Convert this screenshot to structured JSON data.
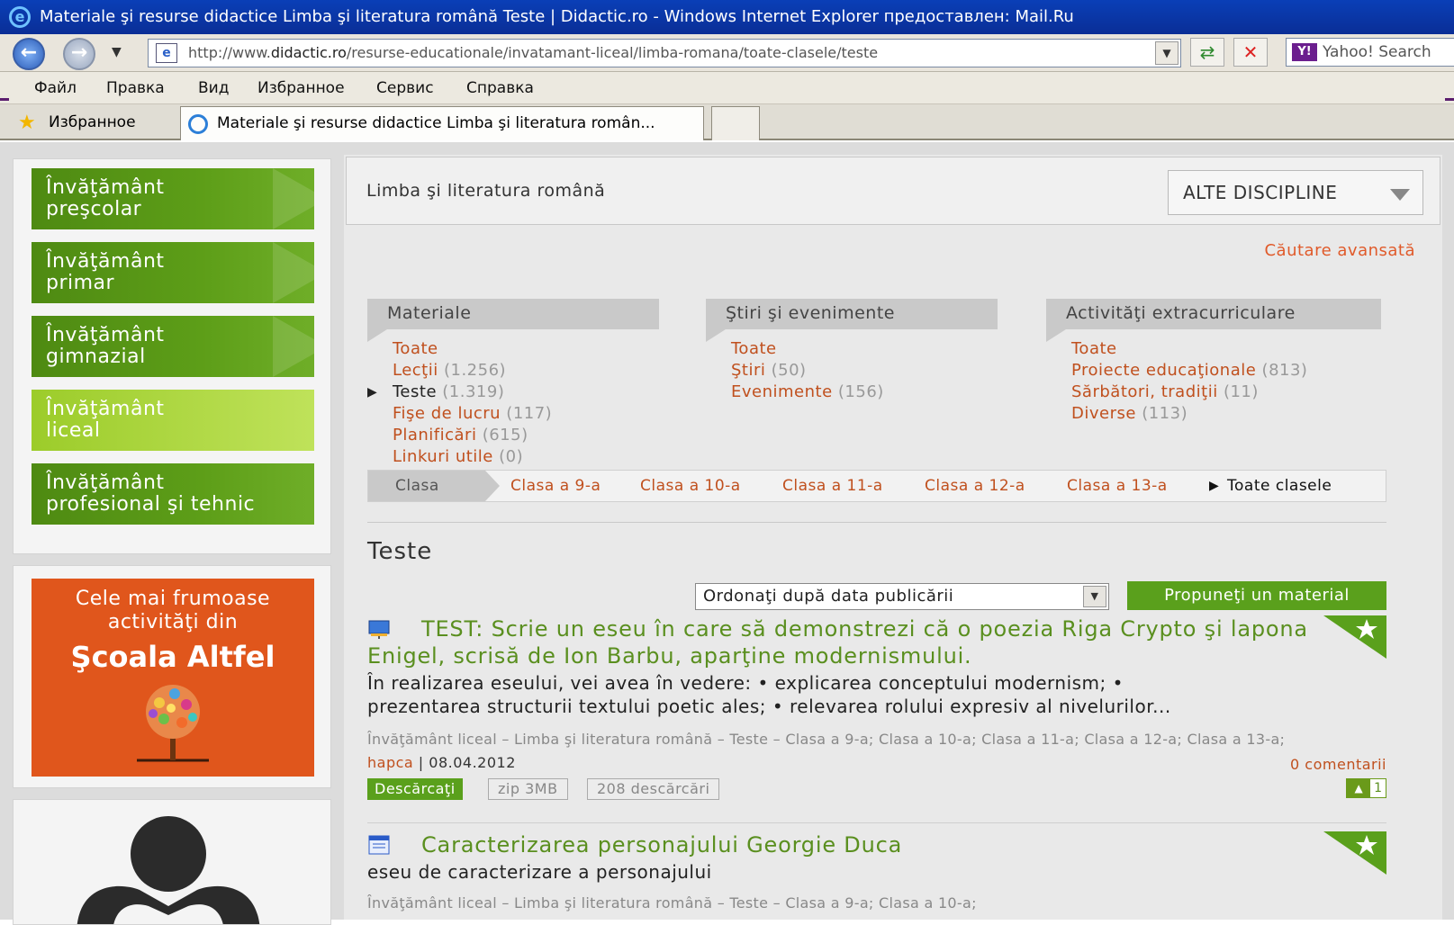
{
  "window": {
    "title": "Materiale şi resurse didactice Limba şi literatura română Teste | Didactic.ro - Windows Internet Explorer предоставлен: Mail.Ru"
  },
  "address": {
    "url_prefix": "http://www.",
    "url_domain": "didactic.ro",
    "url_path": "/resurse-educationale/invatamant-liceal/limba-romana/toate-clasele/teste",
    "search_text": "Yahoo! Search"
  },
  "menu": [
    "Файл",
    "Правка",
    "Вид",
    "Избранное",
    "Сервис",
    "Справка"
  ],
  "favorites": {
    "label": "Избранное",
    "tab_title": "Materiale şi resurse didactice Limba şi literatura român..."
  },
  "sidebar": {
    "levels": [
      {
        "line1": "Învăţământ",
        "line2": "preşcolar"
      },
      {
        "line1": "Învăţământ",
        "line2": "primar"
      },
      {
        "line1": "Învăţământ",
        "line2": "gimnazial"
      },
      {
        "line1": "Învăţământ",
        "line2": "liceal"
      },
      {
        "line1": "Învăţământ",
        "line2": "profesional şi tehnic"
      }
    ],
    "ad_line1": "Cele mai frumoase",
    "ad_line2": "activităţi din",
    "ad_line3": "Şcoala Altfel"
  },
  "discipline": {
    "title": "Limba şi literatura română",
    "other_button": "ALTE DISCIPLINE",
    "advanced_search": "Căutare avansată"
  },
  "columns": {
    "materiale": {
      "heading": "Materiale",
      "items": [
        {
          "label": "Toate",
          "count": ""
        },
        {
          "label": "Lecţii",
          "count": "(1.256)"
        },
        {
          "label": "Teste",
          "count": "(1.319)"
        },
        {
          "label": "Fişe de lucru",
          "count": "(117)"
        },
        {
          "label": "Planificări",
          "count": "(615)"
        },
        {
          "label": "Linkuri utile",
          "count": "(0)"
        }
      ]
    },
    "stiri": {
      "heading": "Ştiri şi evenimente",
      "items": [
        {
          "label": "Toate",
          "count": ""
        },
        {
          "label": "Ştiri",
          "count": "(50)"
        },
        {
          "label": "Evenimente",
          "count": "(156)"
        }
      ]
    },
    "activitati": {
      "heading": "Activităţi extracurriculare",
      "items": [
        {
          "label": "Toate",
          "count": ""
        },
        {
          "label": "Proiecte educaţionale",
          "count": "(813)"
        },
        {
          "label": "Sărbători, tradiţii",
          "count": "(11)"
        },
        {
          "label": "Diverse",
          "count": "(113)"
        }
      ]
    }
  },
  "classes": {
    "label": "Clasa",
    "items": [
      "Clasa a 9-a",
      "Clasa a 10-a",
      "Clasa a 11-a",
      "Clasa a 12-a",
      "Clasa a 13-a",
      "Toate clasele"
    ]
  },
  "section": {
    "title": "Teste",
    "sort_value": "Ordonaţi după data publicării",
    "propose_button": "Propuneţi un material"
  },
  "items": [
    {
      "title": "TEST: Scrie un eseu în care să demonstrezi că o poezia Riga Crypto şi lapona Enigel, scrisă de Ion Barbu, aparţine modernismului.",
      "desc1": "În realizarea eseului, vei avea în vedere: •    explicarea conceptului modernism; •",
      "desc2": "prezentarea structurii textului poetic ales; •    relevarea rolului expresiv al nivelurilor...",
      "meta": "Învăţământ liceal – Limba şi literatura română – Teste – Clasa a 9-a; Clasa a 10-a; Clasa a 11-a; Clasa a 12-a; Clasa a 13-a;",
      "author": "hapca",
      "date": " | 08.04.2012",
      "comments": "0 comentarii",
      "download": "Descărcaţi",
      "format": "zip 3MB",
      "downloads": "208 descărcări",
      "likes": "1"
    },
    {
      "title": "Caracterizarea personajului Georgie Duca",
      "desc1": "eseu de caracterizare a personajului",
      "meta": "Învăţământ liceal – Limba şi literatura română – Teste – Clasa a 9-a; Clasa a 10-a;"
    }
  ],
  "colors": {
    "green": "#5aa01c",
    "orange_link": "#c0501e",
    "ad_orange": "#e0561c",
    "title_bar": "#0a3fb7"
  }
}
